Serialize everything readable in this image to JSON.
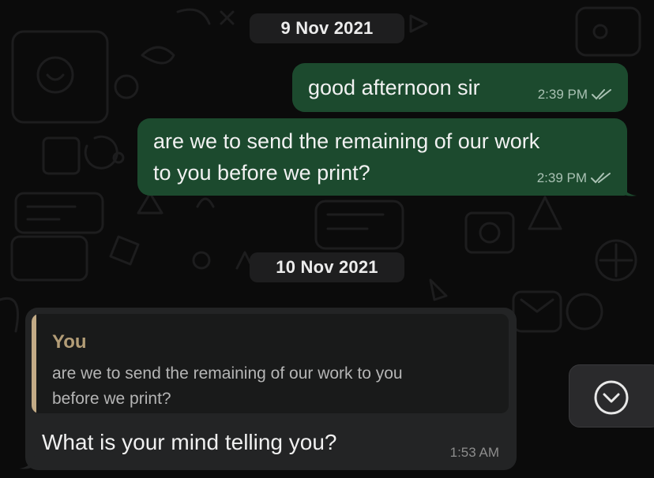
{
  "dates": {
    "first": "9 Nov 2021",
    "second": "10 Nov 2021"
  },
  "messages": {
    "out_1": {
      "text": "good afternoon sir",
      "time": "2:39 PM"
    },
    "out_2": {
      "line_1": "are we to send the remaining of our work",
      "line_2": "to you before we print?",
      "time": "2:39 PM"
    },
    "in_1": {
      "quote_author": "You",
      "quote_line_1": "are we to send the remaining of our work to you",
      "quote_line_2": "before we print?",
      "text": "What is your mind telling you?",
      "time": "1:53 AM"
    }
  },
  "icons": {
    "read_receipt": "double-check-icon",
    "scroll_down": "chevron-down-circle-icon"
  },
  "colors": {
    "outgoing_bubble": "#1c4a2e",
    "incoming_bubble": "#232425",
    "quote_accent": "#c3ab86"
  }
}
